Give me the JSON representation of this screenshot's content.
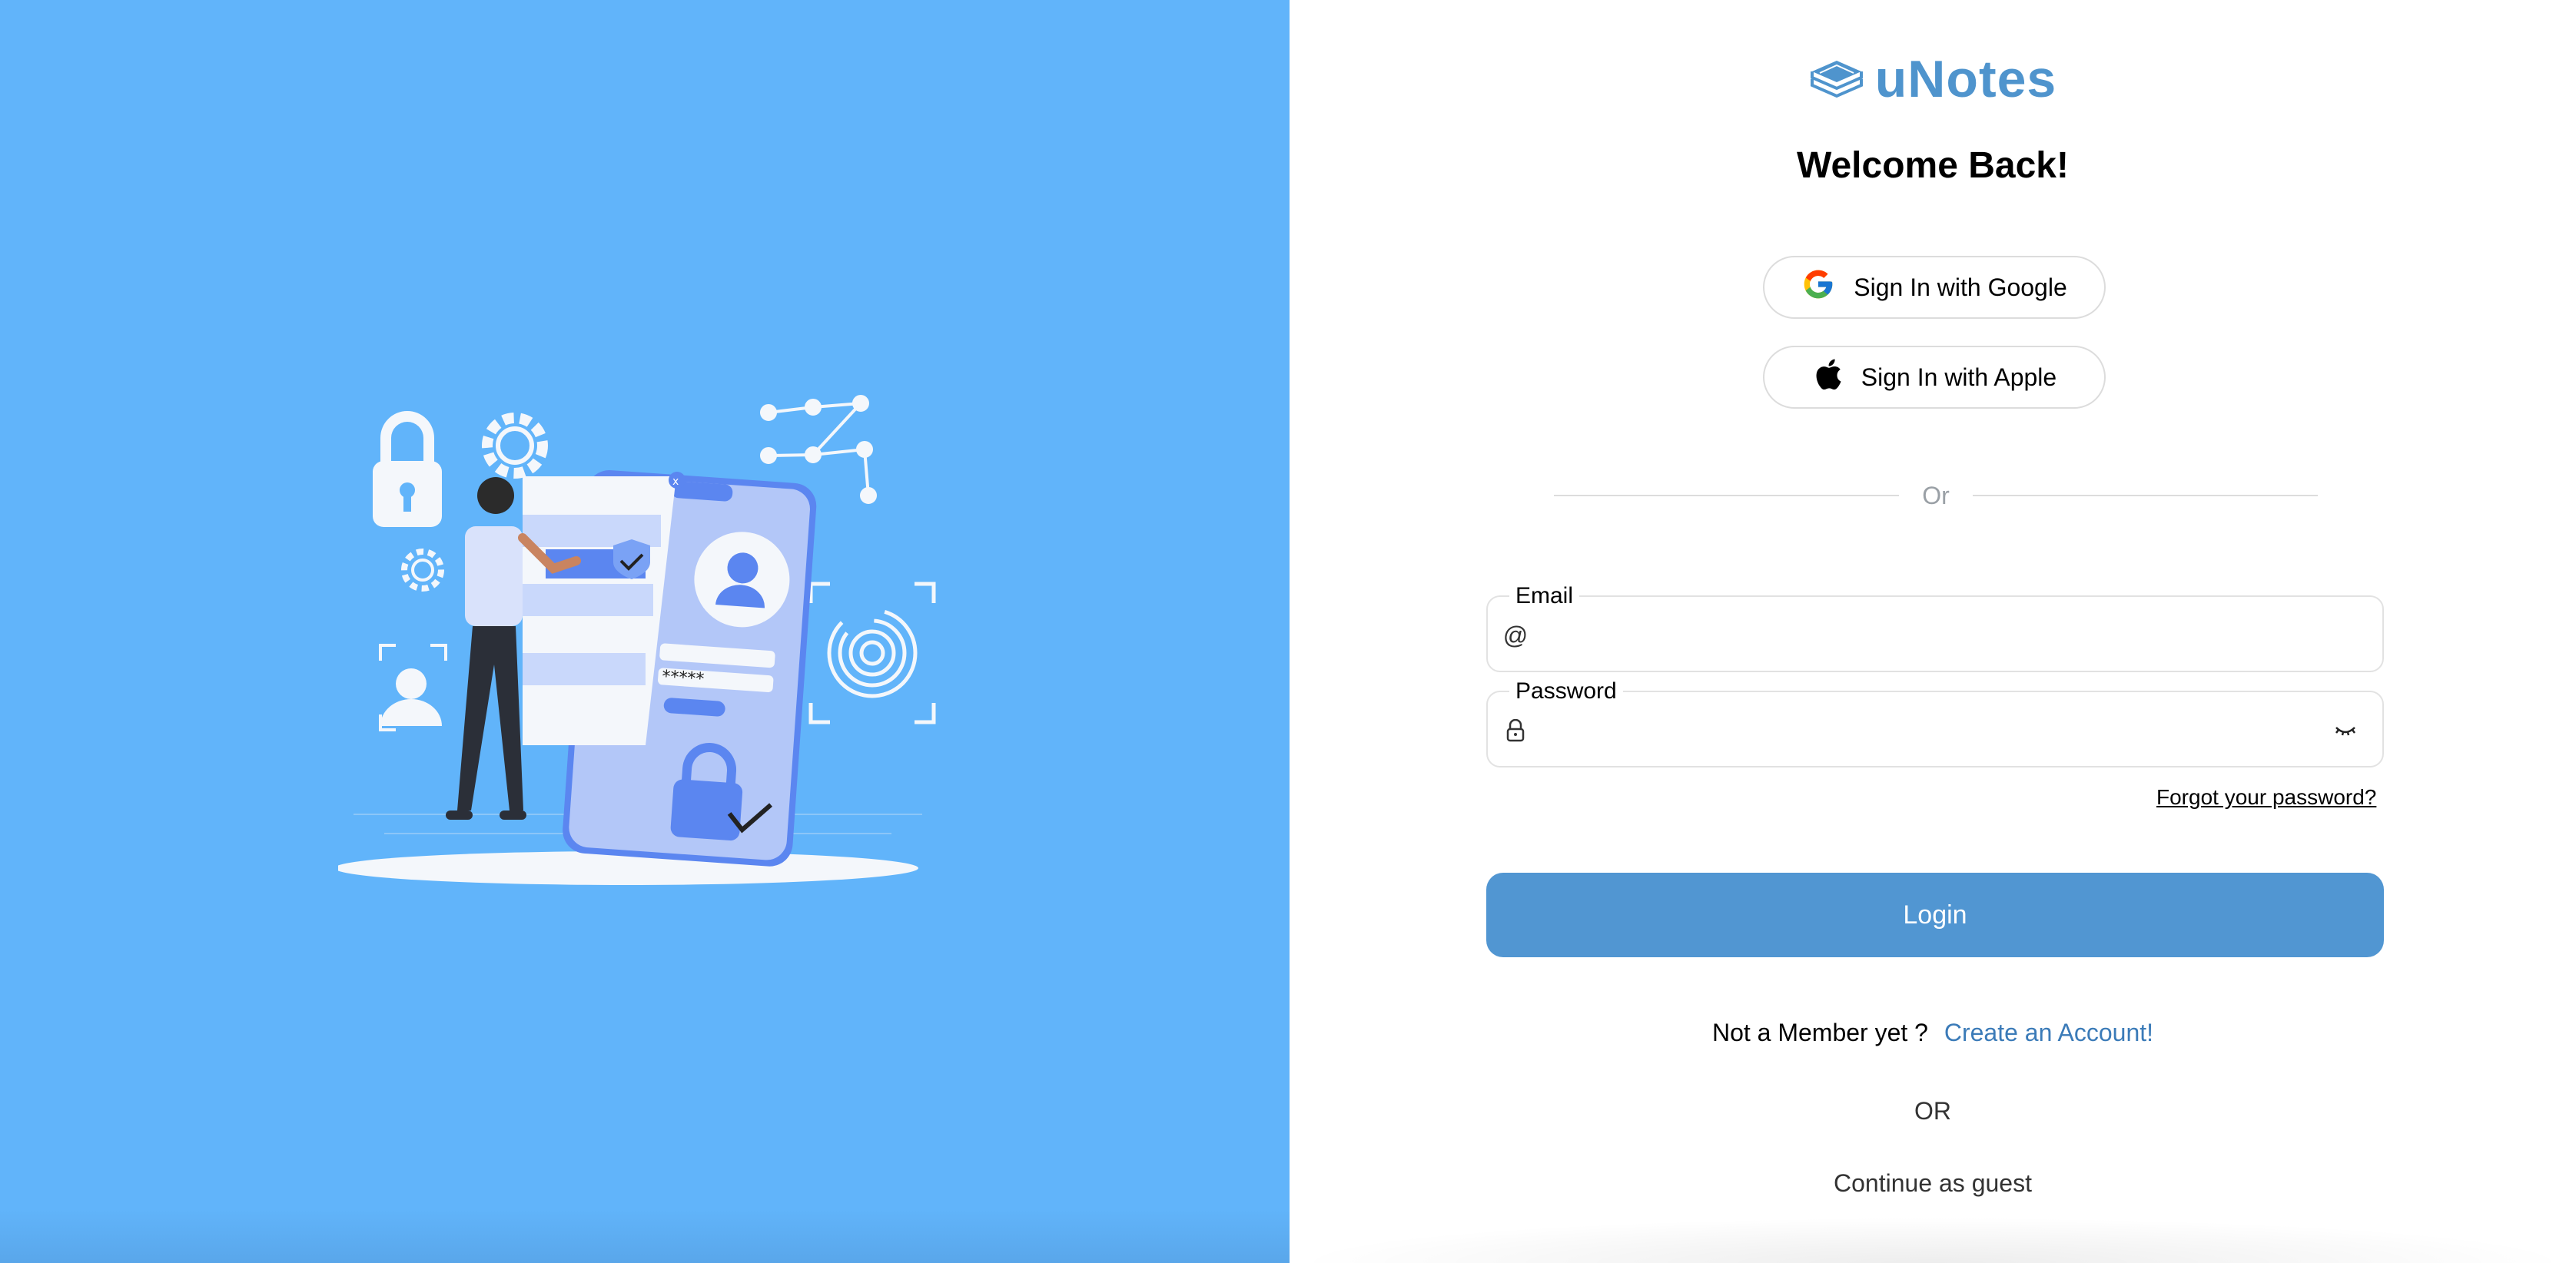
{
  "brand": {
    "name": "uNotes",
    "icon": "stacked-books-icon",
    "color": "#4f94cd"
  },
  "welcome_title": "Welcome Back!",
  "social": {
    "google_label": "Sign In with Google",
    "apple_label": "Sign In with Apple"
  },
  "divider_text": "Or",
  "email": {
    "label": "Email",
    "icon": "at-icon",
    "value": "",
    "placeholder": ""
  },
  "password": {
    "label": "Password",
    "icon": "lock-icon",
    "toggle_icon": "eye-closed-icon",
    "value": "",
    "placeholder": ""
  },
  "forgot_label": "Forgot your password?",
  "login_label": "Login",
  "signup": {
    "question": "Not a Member yet ?",
    "link": "Create an Account!"
  },
  "or_text": "OR",
  "guest_label": "Continue as guest",
  "colors": {
    "left_panel": "#61b4fa",
    "login_button": "#5196d2",
    "link": "#3b7bb8"
  }
}
